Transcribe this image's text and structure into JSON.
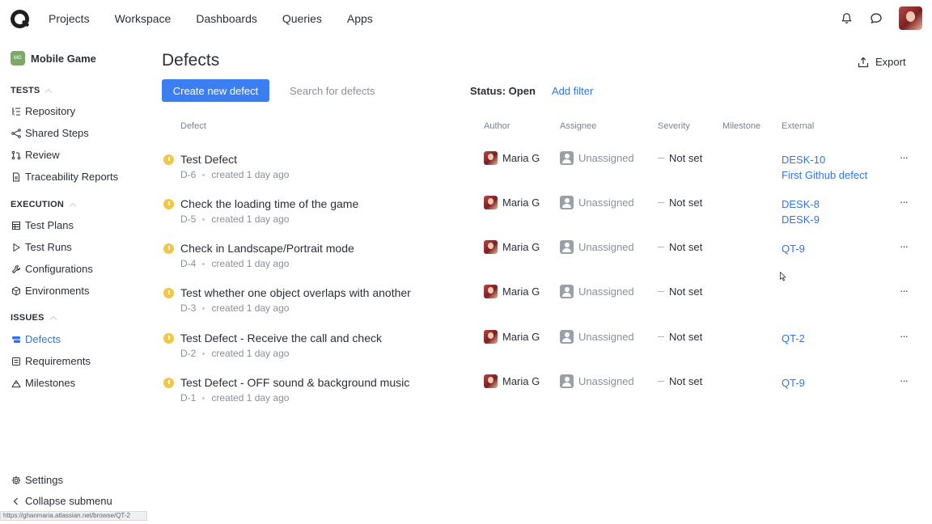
{
  "topnav": {
    "links": [
      "Projects",
      "Workspace",
      "Dashboards",
      "Queries",
      "Apps"
    ]
  },
  "sidebar": {
    "project_badge": "MG",
    "project_name": "Mobile Game",
    "tests_heading": "TESTS",
    "tests_items": [
      "Repository",
      "Shared Steps",
      "Review",
      "Traceability Reports"
    ],
    "execution_heading": "EXECUTION",
    "execution_items": [
      "Test Plans",
      "Test Runs",
      "Configurations",
      "Environments"
    ],
    "issues_heading": "ISSUES",
    "issues_items": [
      "Defects",
      "Requirements",
      "Milestones"
    ],
    "settings": "Settings",
    "collapse": "Collapse submenu"
  },
  "status_bar_url": "https://ghanmaria.atlassian.net/browse/QT-2",
  "page": {
    "title": "Defects",
    "export_label": "Export",
    "create_button": "Create new defect",
    "search_placeholder": "Search for defects",
    "status_filter": "Status: Open",
    "add_filter": "Add filter"
  },
  "table": {
    "headers": [
      "Defect",
      "Author",
      "Assignee",
      "Severity",
      "Milestone",
      "External"
    ],
    "rows": [
      {
        "name": "Test Defect",
        "id": "D-6",
        "created": "created 1 day ago",
        "author": "Maria G",
        "assignee": "Unassigned",
        "severity": "Not set",
        "external": [
          "DESK-10",
          "First Github defect"
        ]
      },
      {
        "name": "Check the loading time of the game",
        "id": "D-5",
        "created": "created 1 day ago",
        "author": "Maria G",
        "assignee": "Unassigned",
        "severity": "Not set",
        "external": [
          "DESK-8",
          "DESK-9"
        ]
      },
      {
        "name": "Check in Landscape/Portrait mode",
        "id": "D-4",
        "created": "created 1 day ago",
        "author": "Maria G",
        "assignee": "Unassigned",
        "severity": "Not set",
        "external": [
          "QT-9"
        ]
      },
      {
        "name": "Test whether one object overlaps with another",
        "id": "D-3",
        "created": "created 1 day ago",
        "author": "Maria G",
        "assignee": "Unassigned",
        "severity": "Not set",
        "external": []
      },
      {
        "name": "Test Defect - Receive the call and check",
        "id": "D-2",
        "created": "created 1 day ago",
        "author": "Maria G",
        "assignee": "Unassigned",
        "severity": "Not set",
        "external": [
          "QT-2"
        ]
      },
      {
        "name": "Test Defect - OFF sound & background music",
        "id": "D-1",
        "created": "created 1 day ago",
        "author": "Maria G",
        "assignee": "Unassigned",
        "severity": "Not set",
        "external": [
          "QT-9"
        ]
      }
    ],
    "more_label": "···"
  },
  "colors": {
    "accent": "#3a7ef2",
    "link": "#2f74eb",
    "status_dot": "#f3c644",
    "project_badge": "#7ea869"
  }
}
